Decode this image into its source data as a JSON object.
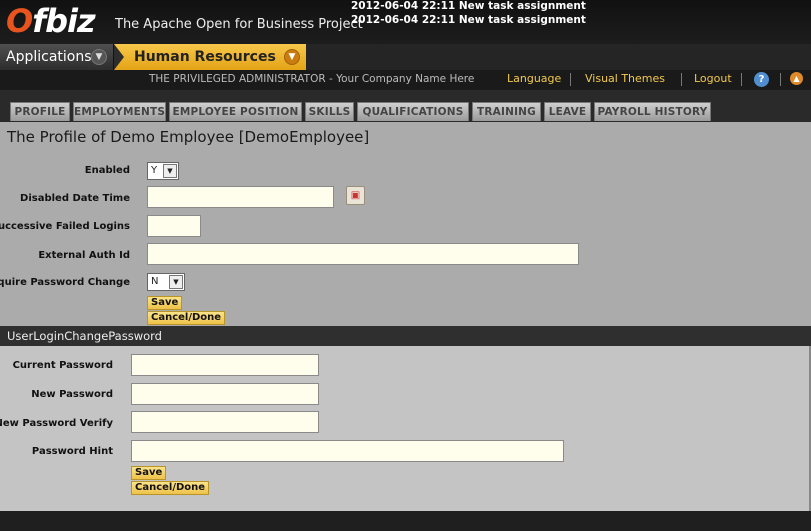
{
  "header": {
    "logo": "Ofbiz",
    "tagline": "The Apache Open for Business Project",
    "notifications": [
      "2012-06-04 22:11 New task assignment",
      "2012-06-04 22:11 New task assignment"
    ]
  },
  "appbar": {
    "applications_label": "Applications",
    "current_app_label": "Human Resources"
  },
  "userbar": {
    "user": "THE PRIVILEGED ADMINISTRATOR - Your Company Name Here",
    "language": "Language",
    "visual_themes": "Visual Themes",
    "logout": "Logout",
    "help": "?",
    "up": "▲"
  },
  "tabs": [
    "PROFILE",
    "EMPLOYMENTS",
    "EMPLOYEE POSITION",
    "SKILLS",
    "QUALIFICATIONS",
    "TRAINING",
    "LEAVE",
    "PAYROLL HISTORY"
  ],
  "form1": {
    "title": "The Profile of Demo Employee [DemoEmployee]",
    "enabled_label": "Enabled",
    "enabled_value": "Y",
    "disabled_date_label": "Disabled Date Time",
    "failed_logins_label": "Successive Failed Logins",
    "external_auth_label": "External Auth Id",
    "require_pw_change_label": "Require Password Change",
    "require_pw_change_value": "N",
    "save": "Save",
    "cancel": "Cancel/Done"
  },
  "form2": {
    "section_title": "UserLoginChangePassword",
    "current_pw_label": "Current Password",
    "new_pw_label": "New Password",
    "verify_pw_label": "New Password Verify",
    "hint_label": "Password Hint",
    "save": "Save",
    "cancel": "Cancel/Done"
  },
  "colors": {
    "accent": "#f2c94c",
    "content_bg": "#ababab",
    "input_bg": "#fffdeb"
  }
}
